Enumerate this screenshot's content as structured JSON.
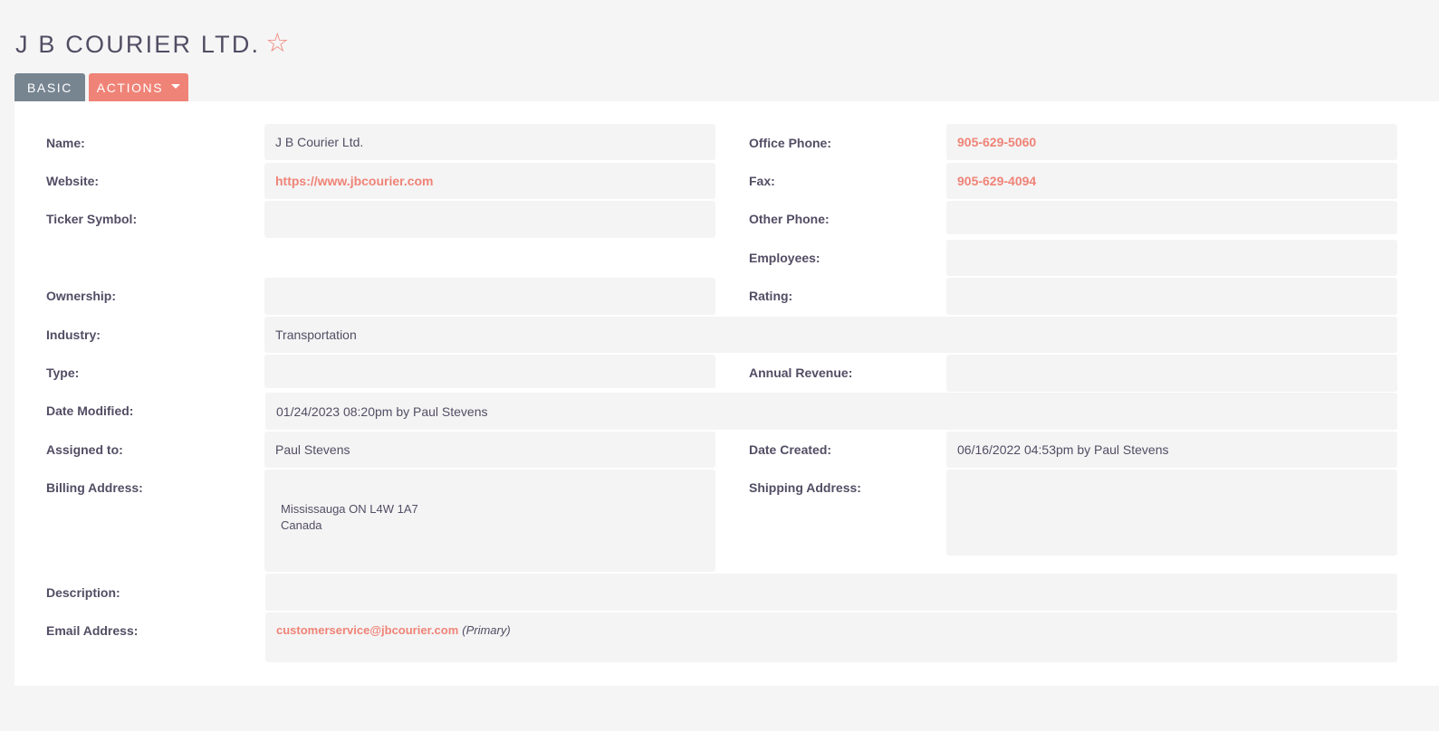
{
  "header": {
    "title": "J B COURIER LTD.",
    "star_icon": "☆"
  },
  "tabs": {
    "basic": "BASIC",
    "actions": "ACTIONS"
  },
  "labels": {
    "name": "Name:",
    "website": "Website:",
    "ticker": "Ticker Symbol:",
    "ownership": "Ownership:",
    "industry": "Industry:",
    "type": "Type:",
    "date_modified": "Date Modified:",
    "assigned_to": "Assigned to:",
    "billing_address": "Billing Address:",
    "description": "Description:",
    "email_address": "Email Address:",
    "office_phone": "Office Phone:",
    "fax": "Fax:",
    "other_phone": "Other Phone:",
    "employees": "Employees:",
    "rating": "Rating:",
    "annual_revenue": "Annual Revenue:",
    "date_created": "Date Created:",
    "shipping_address": "Shipping Address:"
  },
  "values": {
    "name": "J B Courier Ltd.",
    "website": "https://www.jbcourier.com",
    "ticker": "",
    "ownership": "",
    "industry": "Transportation",
    "type": "",
    "date_modified": "01/24/2023 08:20pm by Paul Stevens",
    "assigned_to": "Paul Stevens",
    "billing_address_line1": "Mississauga ON  L4W 1A7",
    "billing_address_line2": "Canada",
    "description": "",
    "email": "customerservice@jbcourier.com",
    "email_tag": "(Primary)",
    "office_phone": "905-629-5060",
    "fax": "905-629-4094",
    "other_phone": "",
    "employees": "",
    "rating": "",
    "annual_revenue": "",
    "date_created": "06/16/2022 04:53pm by Paul Stevens",
    "shipping_address": ""
  },
  "colors": {
    "accent": "#f08377",
    "basic_tab": "#778591",
    "field_bg": "#f4f4f4",
    "text": "#534d64"
  }
}
